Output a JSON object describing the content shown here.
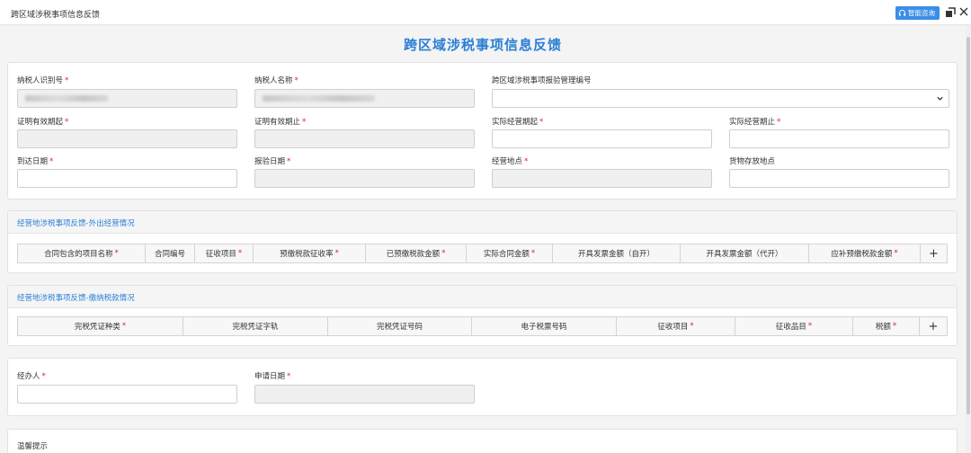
{
  "window": {
    "title": "跨区域涉税事项信息反馈",
    "smart_consult_label": "智能咨询"
  },
  "page_title": "跨区域涉税事项信息反馈",
  "basic_info": {
    "taxpayer_id_label": "纳税人识别号",
    "taxpayer_name_label": "纳税人名称",
    "inspection_no_label": "跨区域涉税事项报验管理编号",
    "cert_valid_from_label": "证明有效期起",
    "cert_valid_to_label": "证明有效期止",
    "actual_op_from_label": "实际经营期起",
    "actual_op_to_label": "实际经营期止",
    "arrival_date_label": "到达日期",
    "inspection_date_label": "报验日期",
    "op_location_label": "经营地点",
    "goods_location_label": "货物存放地点"
  },
  "section_outbound": {
    "title": "经营地涉税事项反馈-外出经营情况",
    "columns": [
      "合同包含的项目名称",
      "合同编号",
      "征收项目",
      "预缴税款征收率",
      "已预缴税款金额",
      "实际合同金额",
      "开具发票金额（自开）",
      "开具发票金额（代开）",
      "应补预缴税款金额"
    ],
    "required": [
      true,
      false,
      true,
      true,
      true,
      true,
      false,
      false,
      true
    ],
    "add_label": "+"
  },
  "section_tax_paid": {
    "title": "经营地涉税事项反馈-缴纳税款情况",
    "columns": [
      "完税凭证种类",
      "完税凭证字轨",
      "完税凭证号码",
      "电子税票号码",
      "征收项目",
      "征收品目",
      "税额"
    ],
    "required": [
      true,
      false,
      false,
      false,
      true,
      true,
      true
    ],
    "add_label": "+"
  },
  "applicant": {
    "handler_label": "经办人",
    "apply_date_label": "申请日期"
  },
  "tips": {
    "label": "温馨提示"
  },
  "colors": {
    "accent": "#2a7fd4",
    "required": "#e02020",
    "smart_button": "#3a8ee6"
  }
}
